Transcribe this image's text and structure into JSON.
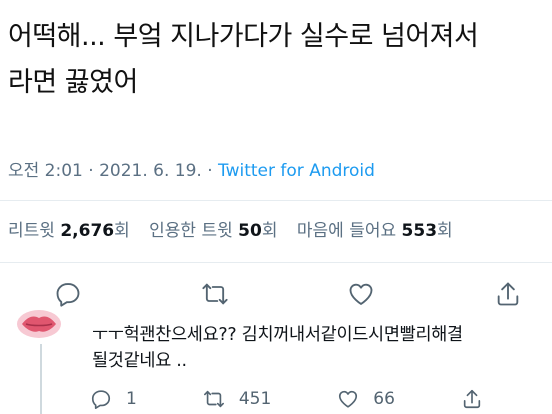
{
  "tweet": {
    "line1": "어떡해... 부엌 지나가다가 실수로 넘어져서",
    "line2": "라면 끓였어",
    "time": "오전 2:01",
    "date": "2021. 6. 19.",
    "sep": "·",
    "source": "Twitter for Android"
  },
  "stats": {
    "retweet_label": "리트윗",
    "retweet_count": "2,676",
    "retweet_unit": "회",
    "quote_label": "인용한 트윗",
    "quote_count": "50",
    "quote_unit": "회",
    "like_label": "마음에 들어요",
    "like_count": "553",
    "like_unit": "회"
  },
  "reply": {
    "line1": "ㅜㅜ헉괜찬으세요?? 김치꺼내서같이드시면빨리해결",
    "line2": "될것같네요 ..",
    "reply_count": "1",
    "retweet_count": "451",
    "like_count": "66"
  },
  "colors": {
    "accent": "#1d9bf0",
    "muted": "#5b7083",
    "divider": "#e6ecf0"
  },
  "icons": [
    "reply-icon",
    "retweet-icon",
    "like-icon",
    "share-icon"
  ]
}
